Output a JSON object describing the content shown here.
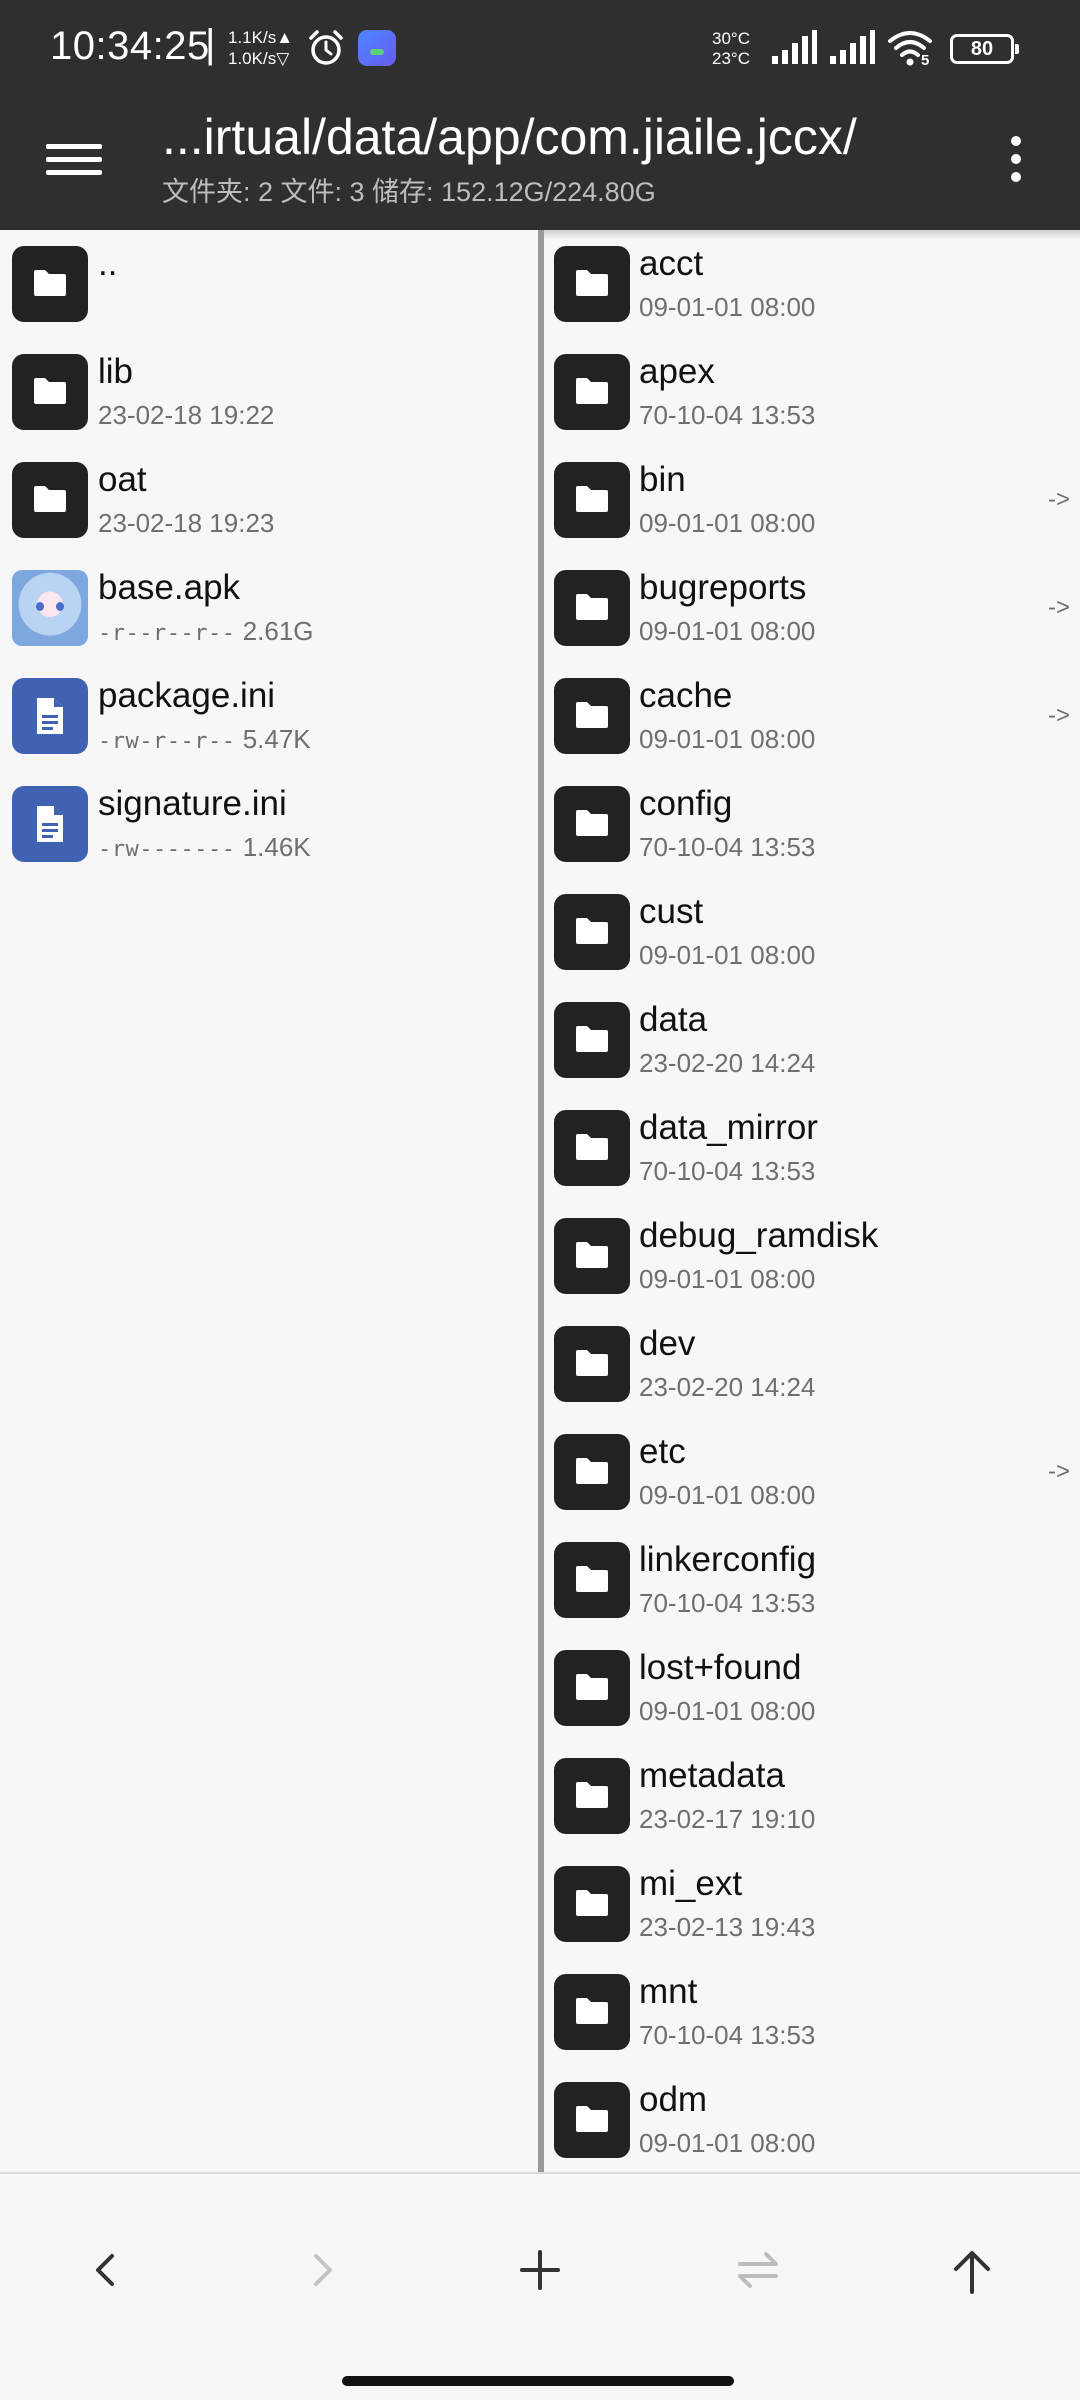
{
  "status_bar": {
    "time": "10:34:25",
    "separator": "|",
    "speed_up": "1.1K/s▲",
    "speed_down": "1.0K/s▽",
    "temp_high": "30°C",
    "temp_low": "23°C",
    "wifi_badge": "5",
    "battery": "80",
    "icons": [
      "alarm-icon",
      "app-notification-icon",
      "signal-icon",
      "signal-icon",
      "wifi-icon",
      "battery-icon"
    ]
  },
  "app_bar": {
    "path": "...irtual/data/app/com.jiaile.jccx/",
    "summary": "文件夹: 2   文件: 3   储存: 152.12G/224.80G"
  },
  "left_pane": {
    "items": [
      {
        "name": "..",
        "meta": "",
        "perm": "",
        "size": "",
        "icon": "folder"
      },
      {
        "name": "lib",
        "meta": "23-02-18 19:22",
        "perm": "",
        "size": "",
        "icon": "folder"
      },
      {
        "name": "oat",
        "meta": "23-02-18 19:23",
        "perm": "",
        "size": "",
        "icon": "folder"
      },
      {
        "name": "base.apk",
        "meta": "",
        "perm": "-r--r--r--",
        "size": "2.61G",
        "icon": "apk"
      },
      {
        "name": "package.ini",
        "meta": "",
        "perm": "-rw-r--r--",
        "size": "5.47K",
        "icon": "doc"
      },
      {
        "name": "signature.ini",
        "meta": "",
        "perm": "-rw-------",
        "size": "1.46K",
        "icon": "doc"
      }
    ]
  },
  "right_pane": {
    "items": [
      {
        "name": "acct",
        "meta": "09-01-01 08:00",
        "link": ""
      },
      {
        "name": "apex",
        "meta": "70-10-04 13:53",
        "link": ""
      },
      {
        "name": "bin",
        "meta": "09-01-01 08:00",
        "link": "->"
      },
      {
        "name": "bugreports",
        "meta": "09-01-01 08:00",
        "link": "->"
      },
      {
        "name": "cache",
        "meta": "09-01-01 08:00",
        "link": "->"
      },
      {
        "name": "config",
        "meta": "70-10-04 13:53",
        "link": ""
      },
      {
        "name": "cust",
        "meta": "09-01-01 08:00",
        "link": ""
      },
      {
        "name": "data",
        "meta": "23-02-20 14:24",
        "link": ""
      },
      {
        "name": "data_mirror",
        "meta": "70-10-04 13:53",
        "link": ""
      },
      {
        "name": "debug_ramdisk",
        "meta": "09-01-01 08:00",
        "link": ""
      },
      {
        "name": "dev",
        "meta": "23-02-20 14:24",
        "link": ""
      },
      {
        "name": "etc",
        "meta": "09-01-01 08:00",
        "link": "->"
      },
      {
        "name": "linkerconfig",
        "meta": "70-10-04 13:53",
        "link": ""
      },
      {
        "name": "lost+found",
        "meta": "09-01-01 08:00",
        "link": ""
      },
      {
        "name": "metadata",
        "meta": "23-02-17 19:10",
        "link": ""
      },
      {
        "name": "mi_ext",
        "meta": "23-02-13 19:43",
        "link": ""
      },
      {
        "name": "mnt",
        "meta": "70-10-04 13:53",
        "link": ""
      },
      {
        "name": "odm",
        "meta": "09-01-01 08:00",
        "link": ""
      }
    ]
  },
  "bottom_bar": {
    "buttons": [
      {
        "name": "back-button",
        "icon": "chevron-left-icon",
        "enabled": true
      },
      {
        "name": "forward-button",
        "icon": "chevron-right-icon",
        "enabled": false
      },
      {
        "name": "add-button",
        "icon": "plus-icon",
        "enabled": true
      },
      {
        "name": "swap-panes-button",
        "icon": "swap-icon",
        "enabled": false
      },
      {
        "name": "parent-dir-button",
        "icon": "arrow-up-icon",
        "enabled": true
      }
    ]
  },
  "colors": {
    "bar_background": "#2f2f2f",
    "folder_icon": "#222222",
    "doc_icon": "#3f62b3",
    "list_background": "#f7f7f7",
    "secondary_text": "#6f6f6f"
  }
}
